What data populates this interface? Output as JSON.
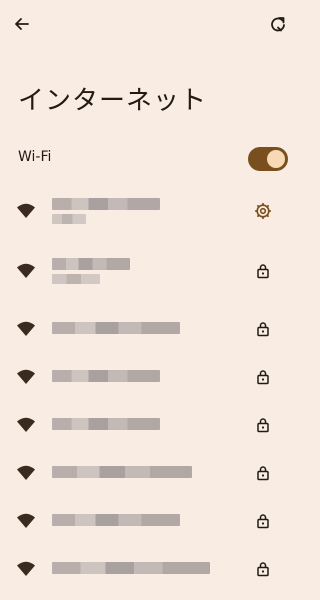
{
  "header": {
    "back_icon": "arrow-back-icon",
    "refresh_icon": "refresh-icon"
  },
  "page": {
    "title": "インターネット"
  },
  "wifi": {
    "label": "Wi-Fi",
    "enabled": true,
    "toggle_color": "#7a4f1f"
  },
  "networks": [
    {
      "ssid": "",
      "detail": "",
      "action_icon": "gear-icon",
      "connected": true
    },
    {
      "ssid": "",
      "detail": "",
      "action_icon": "lock-icon"
    },
    {
      "ssid": "",
      "action_icon": "lock-icon"
    },
    {
      "ssid": "",
      "action_icon": "lock-icon"
    },
    {
      "ssid": "",
      "action_icon": "lock-icon"
    },
    {
      "ssid": "",
      "action_icon": "lock-icon"
    },
    {
      "ssid": "",
      "action_icon": "lock-icon"
    },
    {
      "ssid": "",
      "action_icon": "lock-icon"
    }
  ]
}
